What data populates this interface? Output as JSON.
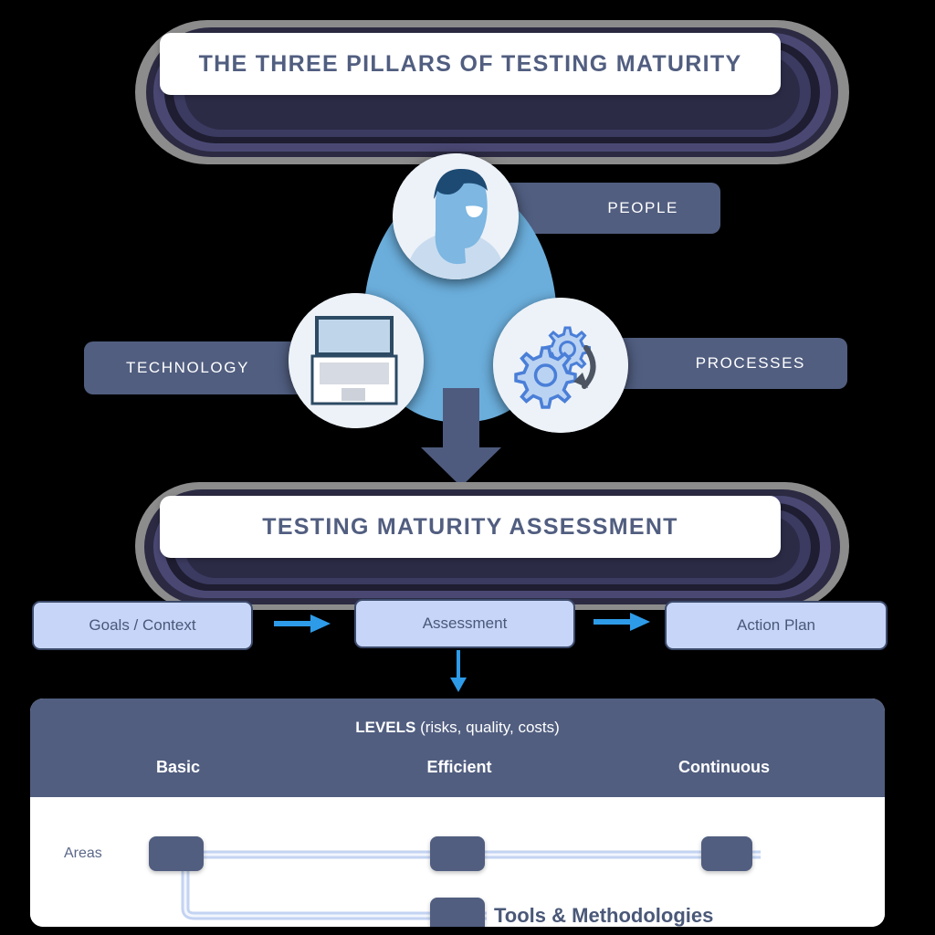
{
  "colors": {
    "slate": "#515E80",
    "navy_ring": "#3C3A63",
    "gray_ring": "#8C8C8C",
    "light_blue": "#6BAEDC",
    "arrow_blue": "#2E9BE8",
    "flow_fill": "#C7D5F9",
    "flow_border": "#3C4A6B",
    "white": "#FFFFFF",
    "title_text": "#515E80",
    "connector": "#C3D3F2"
  },
  "top_banner": {
    "title": "THE THREE PILLARS OF TESTING MATURITY"
  },
  "pillars": {
    "people": {
      "label": "PEOPLE",
      "icon": "person-icon"
    },
    "technology": {
      "label": "TECHNOLOGY",
      "icon": "laptop-icon"
    },
    "processes": {
      "label": "PROCESSES",
      "icon": "gears-icon"
    }
  },
  "down_arrow": {
    "icon": "down-arrow-icon"
  },
  "assessment_banner": {
    "title": "TESTING MATURITY ASSESSMENT"
  },
  "flow": {
    "steps": [
      {
        "label": "Goals / Context"
      },
      {
        "label": "Assessment"
      },
      {
        "label": "Action Plan"
      }
    ],
    "connector_icon": "right-arrow-icon",
    "down_connector_icon": "down-arrow-thin-icon"
  },
  "levels_panel": {
    "header_title_bold": "LEVELS",
    "header_title_rest": " (risks, quality, costs)",
    "levels": [
      "Basic",
      "Efficient",
      "Continuous"
    ],
    "areas_label": "Areas",
    "tools_label": "Tools & Methodologies",
    "nodes": [
      {
        "name": "area-node-basic"
      },
      {
        "name": "area-node-efficient"
      },
      {
        "name": "area-node-continuous"
      },
      {
        "name": "tools-node"
      }
    ]
  },
  "chart_data": {
    "type": "diagram",
    "title": "The Three Pillars of Testing Maturity",
    "pillars": [
      "People",
      "Technology",
      "Processes"
    ],
    "process_steps": [
      "Goals / Context",
      "Assessment",
      "Action Plan"
    ],
    "maturity_levels": [
      "Basic",
      "Efficient",
      "Continuous"
    ],
    "level_dimensions": [
      "risks",
      "quality",
      "costs"
    ],
    "area_rows": [
      {
        "name": "Areas",
        "level_markers": [
          "Basic",
          "Efficient",
          "Continuous"
        ]
      },
      {
        "name": "Tools & Methodologies",
        "level_markers": [
          "Efficient"
        ]
      }
    ]
  }
}
